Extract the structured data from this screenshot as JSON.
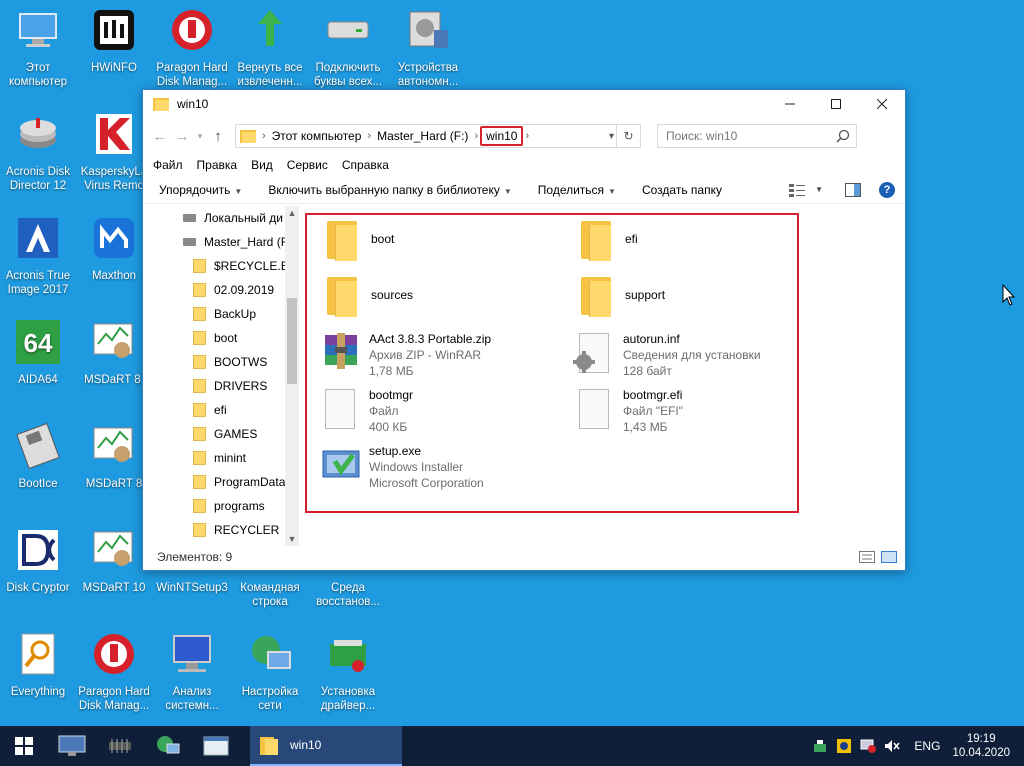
{
  "desktop": {
    "icons": [
      {
        "label": "Этот компьютер",
        "icon": "computer-icon"
      },
      {
        "label": "HWiNFO",
        "icon": "hwinfo-icon"
      },
      {
        "label": "Paragon Hard Disk Manag...",
        "icon": "paragon-icon"
      },
      {
        "label": "Вернуть все извлеченн...",
        "icon": "green-arrow-icon"
      },
      {
        "label": "Подключить буквы всех...",
        "icon": "drive-icon"
      },
      {
        "label": "Устройства автономн...",
        "icon": "devices-icon"
      },
      {
        "label": "Acronis Disk Director 12",
        "icon": "acronis-disk-icon"
      },
      {
        "label": "KasperskyLa Virus Remo",
        "icon": "kaspersky-icon"
      },
      {
        "label": "Acronis True Image 2017",
        "icon": "acronis-true-icon"
      },
      {
        "label": "Maxthon",
        "icon": "maxthon-icon"
      },
      {
        "label": "AIDA64",
        "icon": "aida64-icon"
      },
      {
        "label": "MSDaRT 8.",
        "icon": "msdart-icon"
      },
      {
        "label": "BootIce",
        "icon": "bootice-icon"
      },
      {
        "label": "MSDaRT 8",
        "icon": "msdart-icon"
      },
      {
        "label": "Disk Cryptor",
        "icon": "diskcryptor-icon"
      },
      {
        "label": "MSDaRT 10",
        "icon": "msdart-icon"
      },
      {
        "label": "WinNTSetup3",
        "icon": "winntsetup-icon"
      },
      {
        "label": "Командная строка",
        "icon": "cmd-icon"
      },
      {
        "label": "Среда восстанов...",
        "icon": "recovery-icon"
      },
      {
        "label": "Everything",
        "icon": "everything-icon"
      },
      {
        "label": "Paragon Hard Disk Manag...",
        "icon": "paragon-icon"
      },
      {
        "label": "Анализ системн...",
        "icon": "analysis-icon"
      },
      {
        "label": "Настройка сети",
        "icon": "network-icon"
      },
      {
        "label": "Установка драйвер...",
        "icon": "driver-install-icon"
      }
    ]
  },
  "window": {
    "title": "win10",
    "breadcrumb": [
      "Этот компьютер",
      "Master_Hard (F:)",
      "win10"
    ],
    "search_placeholder": "Поиск: win10",
    "menu": [
      "Файл",
      "Правка",
      "Вид",
      "Сервис",
      "Справка"
    ],
    "toolbar": {
      "organize": "Упорядочить",
      "include": "Включить выбранную папку в библиотеку",
      "share": "Поделиться",
      "new_folder": "Создать папку"
    },
    "nav": [
      {
        "label": "Локальный ди",
        "type": "drive"
      },
      {
        "label": "Master_Hard (F",
        "type": "drive"
      },
      {
        "label": "$RECYCLE.BIN",
        "type": "folder"
      },
      {
        "label": "02.09.2019",
        "type": "folder"
      },
      {
        "label": "BackUp",
        "type": "folder"
      },
      {
        "label": "boot",
        "type": "folder"
      },
      {
        "label": "BOOTWS",
        "type": "folder"
      },
      {
        "label": "DRIVERS",
        "type": "folder"
      },
      {
        "label": "efi",
        "type": "folder"
      },
      {
        "label": "GAMES",
        "type": "folder"
      },
      {
        "label": "minint",
        "type": "folder"
      },
      {
        "label": "ProgramData",
        "type": "folder"
      },
      {
        "label": "programs",
        "type": "folder"
      },
      {
        "label": "RECYCLER",
        "type": "folder"
      }
    ],
    "files": [
      {
        "name": "boot",
        "type": "folder",
        "line2": "",
        "line3": ""
      },
      {
        "name": "efi",
        "type": "folder",
        "line2": "",
        "line3": ""
      },
      {
        "name": "sources",
        "type": "folder",
        "line2": "",
        "line3": ""
      },
      {
        "name": "support",
        "type": "folder",
        "line2": "",
        "line3": ""
      },
      {
        "name": "AAct 3.8.3 Portable.zip",
        "type": "winrar",
        "line2": "Архив ZIP - WinRAR",
        "line3": "1,78 МБ"
      },
      {
        "name": "autorun.inf",
        "type": "settings",
        "line2": "Сведения для установки",
        "line3": "128 байт"
      },
      {
        "name": "bootmgr",
        "type": "file",
        "line2": "Файл",
        "line3": "400 КБ"
      },
      {
        "name": "bootmgr.efi",
        "type": "file",
        "line2": "Файл \"EFI\"",
        "line3": "1,43 МБ"
      },
      {
        "name": "setup.exe",
        "type": "installer",
        "line2": "Windows Installer",
        "line3": "Microsoft Corporation"
      }
    ],
    "status": "Элементов: 9"
  },
  "taskbar": {
    "active_task": "win10",
    "lang": "ENG",
    "time": "19:19",
    "date": "10.04.2020"
  }
}
